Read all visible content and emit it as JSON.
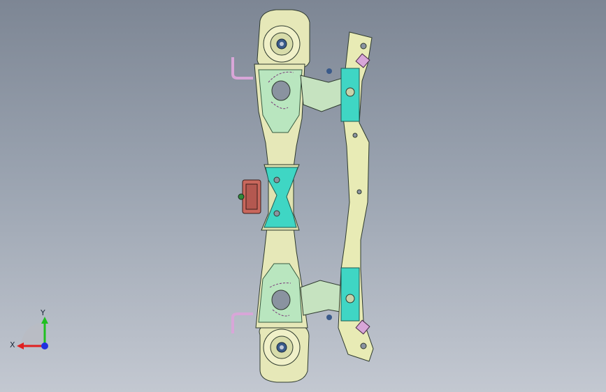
{
  "viewport": {
    "background_top": "#7d8694",
    "background_bottom": "#c3c8d1"
  },
  "model": {
    "part_colors": {
      "frame": "#e6e8b8",
      "cover": "#3fd6c4",
      "bracket": "#8ad0c0",
      "mount": "#c9675c",
      "rail": "#e8ebb5",
      "pin": "#d8a6d8"
    }
  },
  "triad": {
    "x_label": "X",
    "y_label": "Y",
    "x_color": "#e02020",
    "y_color": "#20c020",
    "z_color": "#2030e0"
  }
}
